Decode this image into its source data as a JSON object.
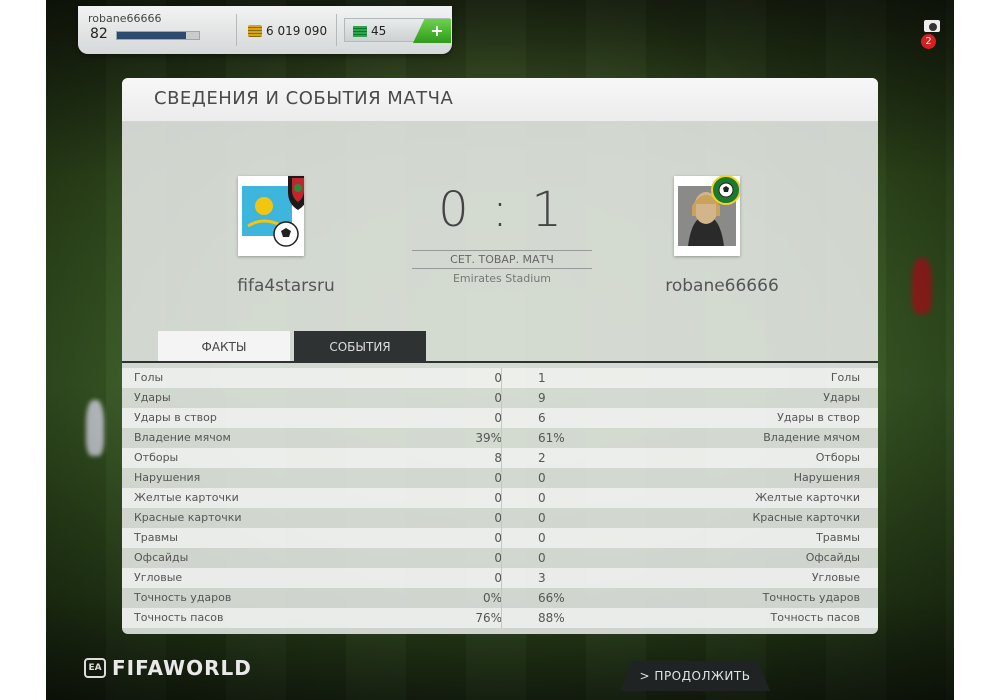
{
  "user": {
    "name": "robane66666",
    "level": "82",
    "level_progress": 0.84,
    "coins": "6 019 090",
    "points": "45",
    "add_label": "+"
  },
  "notifications": {
    "count": "2"
  },
  "panel": {
    "title": "СВЕДЕНИЯ И СОБЫТИЯ МАТЧА"
  },
  "match": {
    "home": "fifa4starsru",
    "away": "robane66666",
    "score": "0 : 1",
    "type": "СЕТ. ТОВАР. МАТЧ",
    "stadium": "Emirates Stadium"
  },
  "tabs": [
    {
      "label": "ФАКТЫ",
      "active": true
    },
    {
      "label": "СОБЫТИЯ",
      "active": false
    }
  ],
  "stats": [
    {
      "label": "Голы",
      "home": "0",
      "away": "1"
    },
    {
      "label": "Удары",
      "home": "0",
      "away": "9"
    },
    {
      "label": "Удары в створ",
      "home": "0",
      "away": "6"
    },
    {
      "label": "Владение мячом",
      "home": "39%",
      "away": "61%"
    },
    {
      "label": "Отборы",
      "home": "8",
      "away": "2"
    },
    {
      "label": "Нарушения",
      "home": "0",
      "away": "0"
    },
    {
      "label": "Желтые карточки",
      "home": "0",
      "away": "0"
    },
    {
      "label": "Красные карточки",
      "home": "0",
      "away": "0"
    },
    {
      "label": "Травмы",
      "home": "0",
      "away": "0"
    },
    {
      "label": "Офсайды",
      "home": "0",
      "away": "0"
    },
    {
      "label": "Угловые",
      "home": "0",
      "away": "3"
    },
    {
      "label": "Точность ударов",
      "home": "0%",
      "away": "66%"
    },
    {
      "label": "Точность пасов",
      "home": "76%",
      "away": "88%"
    }
  ],
  "footer": {
    "logo": "FIFAWORLD",
    "ea": "EA",
    "continue_label": "> ПРОДОЛЖИТЬ"
  },
  "colors": {
    "accent_green": "#2f9a1c",
    "tab_dark": "#2e3233",
    "notification_red": "#d81f1f"
  }
}
